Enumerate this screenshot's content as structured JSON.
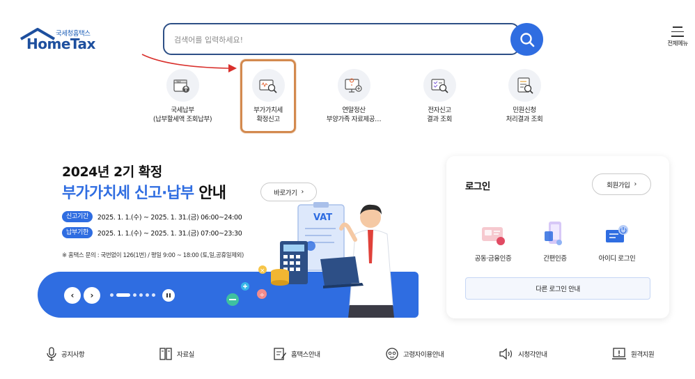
{
  "header": {
    "logo_sub": "국세청홈택스",
    "logo_main": "HomeTax",
    "search_placeholder": "검색어를 입력하세요!",
    "menu_label": "전체메뉴"
  },
  "quick_menu": [
    {
      "line1": "국세납부",
      "line2": "(납부할세액 조회납부)",
      "icon": "tax-payment-icon"
    },
    {
      "line1": "부가가치세",
      "line2": "확정신고",
      "icon": "vat-report-icon"
    },
    {
      "line1": "연말정산",
      "line2": "부양가족 자료제공…",
      "icon": "year-end-settlement-icon"
    },
    {
      "line1": "전자신고",
      "line2": "결과 조회",
      "icon": "e-filing-result-icon"
    },
    {
      "line1": "민원신청",
      "line2": "처리결과 조회",
      "icon": "civil-petition-icon"
    }
  ],
  "banner": {
    "line1": "2024년 2기 확정",
    "line2_blue": "부가가치세 신고·납부",
    "line2_rest": " 안내",
    "go_label": "바로가기",
    "period1_tag": "신고기간",
    "period1_text": "2025. 1. 1.(수) ~ 2025. 1. 31.(금) 06:00~24:00",
    "period2_tag": "납부기한",
    "period2_text": "2025. 1. 1.(수) ~ 2025. 1. 31.(금) 07:00~23:30",
    "notice": "※ 홈택스 문의 : 국번없이 126(1번) / 평일 9:00 ~ 18:00 (토,일,공휴일제외)",
    "illus_text": "VAT"
  },
  "login": {
    "title": "로그인",
    "join_label": "회원가입",
    "options": [
      {
        "label": "공동·금융인증",
        "icon": "certificate-icon"
      },
      {
        "label": "간편인증",
        "icon": "simple-auth-icon"
      },
      {
        "label": "아이디 로그인",
        "icon": "id-login-icon"
      }
    ],
    "other_label": "다른 로그인 안내"
  },
  "footer": [
    {
      "label": "공지사항",
      "icon": "microphone-icon"
    },
    {
      "label": "자료실",
      "icon": "archive-icon"
    },
    {
      "label": "홈택스안내",
      "icon": "guide-icon"
    },
    {
      "label": "고령자이용안내",
      "icon": "senior-icon"
    },
    {
      "label": "시청각안내",
      "icon": "speaker-icon"
    },
    {
      "label": "원격지원",
      "icon": "remote-support-icon"
    }
  ],
  "colors": {
    "brand_blue": "#2f6de1",
    "navy": "#2d4f86",
    "highlight": "#d38a4f",
    "arrow": "#d9302c"
  }
}
